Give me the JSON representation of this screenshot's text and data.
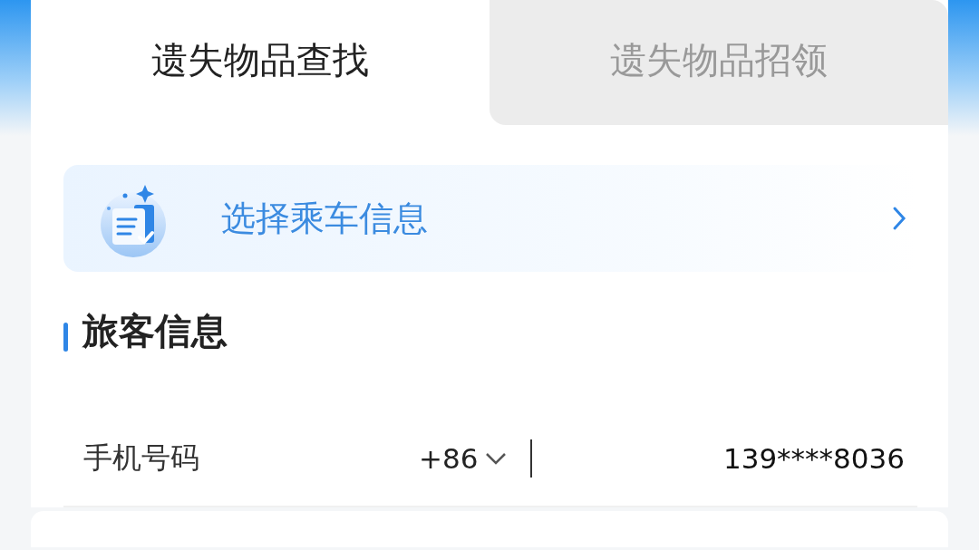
{
  "tabs": [
    {
      "label": "遗失物品查找",
      "selected": true
    },
    {
      "label": "遗失物品招领",
      "selected": false
    }
  ],
  "ride_selector": {
    "label": "选择乘车信息"
  },
  "section": {
    "title": "旅客信息"
  },
  "phone_field": {
    "label": "手机号码",
    "country_code": "+86",
    "value": "139****8036"
  }
}
